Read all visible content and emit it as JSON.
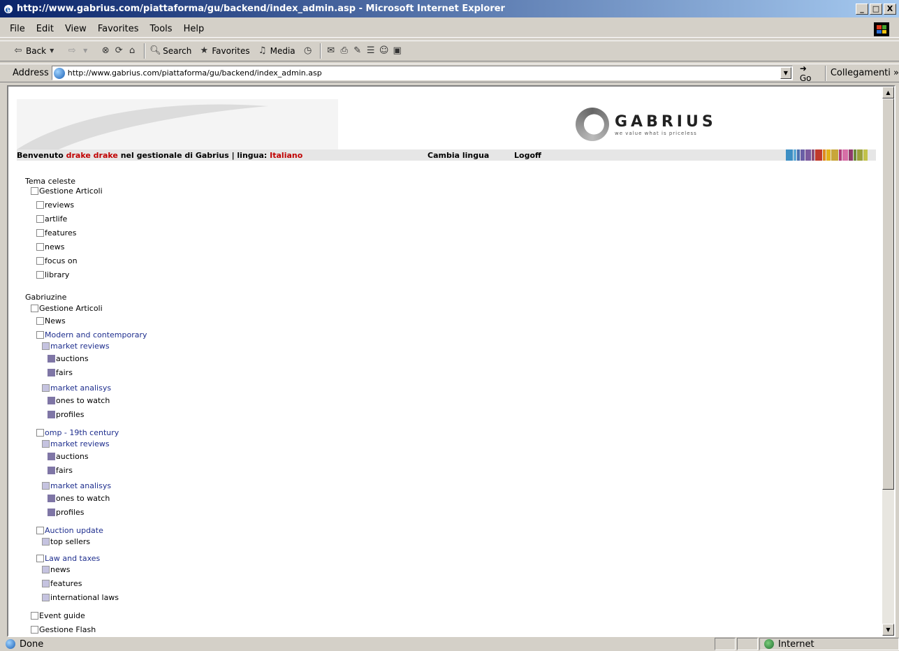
{
  "window": {
    "title": "http://www.gabrius.com/piattaforma/gu/backend/index_admin.asp - Microsoft Internet Explorer",
    "min": "_",
    "max": "□",
    "close": "X"
  },
  "menu": [
    "File",
    "Edit",
    "View",
    "Favorites",
    "Tools",
    "Help"
  ],
  "toolbar": {
    "back": "Back",
    "search": "Search",
    "favorites": "Favorites",
    "media": "Media"
  },
  "address": {
    "label": "Address",
    "url": "http://www.gabrius.com/piattaforma/gu/backend/index_admin.asp",
    "go": "Go",
    "links": "Collegamenti"
  },
  "logo": {
    "word": "GABRIUS",
    "tagline": "we value what is priceless"
  },
  "welcome": {
    "prefix": "Benvenuto ",
    "user": "drake drake",
    "middle": " nel gestionale di Gabrius | lingua: ",
    "language": "Italiano",
    "change_language": "Cambia lingua",
    "logoff": "Logoff"
  },
  "colorbars": [
    "#3d8fc4",
    "#5fa9d6",
    "#4a6fb0",
    "#6a5fa6",
    "#7b5a9e",
    "#8c4f7a",
    "#c0392b",
    "#e08a1e",
    "#e2b21b",
    "#c8a63a",
    "#b23a7a",
    "#d66fa6",
    "#8f3a6a",
    "#6d8a3a",
    "#9aa03a",
    "#c2c24a"
  ],
  "tree": {
    "section1": "Tema celeste",
    "s1_gestione": "Gestione Articoli",
    "s1_items": [
      "reviews",
      "artlife",
      "features",
      "news",
      "focus on",
      "library"
    ],
    "section2": "Gabriuzine",
    "s2_gestione": "Gestione Articoli",
    "s2_news": "News",
    "modern": "Modern and contemporary",
    "market_reviews": "market reviews",
    "auctions": "auctions",
    "fairs": "fairs",
    "market_analisys": "market analisys",
    "ones_to_watch": "ones to watch",
    "profiles": "profiles",
    "omp": "omp - 19th century",
    "auction_update": "Auction update",
    "top_sellers": "top sellers",
    "law_taxes": "Law and taxes",
    "news": "news",
    "features": "features",
    "international_laws": "international laws",
    "event_guide": "Event guide",
    "gestione_flash": "Gestione Flash"
  },
  "status": {
    "text": "Done",
    "zone": "Internet"
  }
}
